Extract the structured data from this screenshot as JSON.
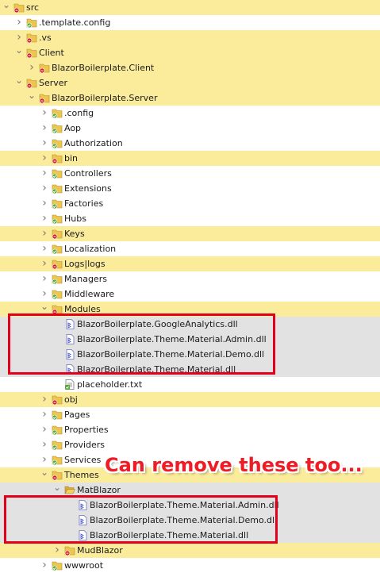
{
  "tree": [
    {
      "label": "src",
      "chevron": "down",
      "icon": "folder-red-icon",
      "bg": "yellow",
      "depth": 0
    },
    {
      "label": ".template.config",
      "chevron": "right",
      "icon": "folder-green-icon",
      "bg": "white",
      "depth": 1
    },
    {
      "label": ".vs",
      "chevron": "right",
      "icon": "folder-red-icon",
      "bg": "yellow",
      "depth": 1
    },
    {
      "label": "Client",
      "chevron": "down",
      "icon": "folder-red-icon",
      "bg": "yellow",
      "depth": 1
    },
    {
      "label": "BlazorBoilerplate.Client",
      "chevron": "right",
      "icon": "folder-red-icon",
      "bg": "yellow",
      "depth": 2
    },
    {
      "label": "Server",
      "chevron": "down",
      "icon": "folder-red-icon",
      "bg": "yellow",
      "depth": 1
    },
    {
      "label": "BlazorBoilerplate.Server",
      "chevron": "down",
      "icon": "folder-red-icon",
      "bg": "yellow",
      "depth": 2
    },
    {
      "label": ".config",
      "chevron": "right",
      "icon": "folder-green-icon",
      "bg": "white",
      "depth": 3
    },
    {
      "label": "Aop",
      "chevron": "right",
      "icon": "folder-green-icon",
      "bg": "white",
      "depth": 3
    },
    {
      "label": "Authorization",
      "chevron": "right",
      "icon": "folder-green-icon",
      "bg": "white",
      "depth": 3
    },
    {
      "label": "bin",
      "chevron": "right",
      "icon": "folder-red-icon",
      "bg": "yellow",
      "depth": 3
    },
    {
      "label": "Controllers",
      "chevron": "right",
      "icon": "folder-green-icon",
      "bg": "white",
      "depth": 3
    },
    {
      "label": "Extensions",
      "chevron": "right",
      "icon": "folder-green-icon",
      "bg": "white",
      "depth": 3
    },
    {
      "label": "Factories",
      "chevron": "right",
      "icon": "folder-green-icon",
      "bg": "white",
      "depth": 3
    },
    {
      "label": "Hubs",
      "chevron": "right",
      "icon": "folder-green-icon",
      "bg": "white",
      "depth": 3
    },
    {
      "label": "Keys",
      "chevron": "right",
      "icon": "folder-red-icon",
      "bg": "yellow",
      "depth": 3
    },
    {
      "label": "Localization",
      "chevron": "right",
      "icon": "folder-green-icon",
      "bg": "white",
      "depth": 3
    },
    {
      "label": "Logs|logs",
      "chevron": "right",
      "icon": "folder-red-icon",
      "bg": "yellow",
      "depth": 3
    },
    {
      "label": "Managers",
      "chevron": "right",
      "icon": "folder-green-icon",
      "bg": "white",
      "depth": 3
    },
    {
      "label": "Middleware",
      "chevron": "right",
      "icon": "folder-green-icon",
      "bg": "white",
      "depth": 3
    },
    {
      "label": "Modules",
      "chevron": "down",
      "icon": "folder-red-icon",
      "bg": "yellow",
      "depth": 3
    },
    {
      "label": "BlazorBoilerplate.GoogleAnalytics.dll",
      "chevron": "",
      "icon": "dll-file-icon",
      "bg": "gray",
      "depth": 4
    },
    {
      "label": "BlazorBoilerplate.Theme.Material.Admin.dll",
      "chevron": "",
      "icon": "dll-file-icon",
      "bg": "gray",
      "depth": 4
    },
    {
      "label": "BlazorBoilerplate.Theme.Material.Demo.dll",
      "chevron": "",
      "icon": "dll-file-icon",
      "bg": "gray",
      "depth": 4
    },
    {
      "label": "BlazorBoilerplate.Theme.Material.dll",
      "chevron": "",
      "icon": "dll-file-icon",
      "bg": "gray",
      "depth": 4
    },
    {
      "label": "placeholder.txt",
      "chevron": "",
      "icon": "text-file-icon",
      "bg": "white",
      "depth": 4
    },
    {
      "label": "obj",
      "chevron": "right",
      "icon": "folder-red-icon",
      "bg": "yellow",
      "depth": 3
    },
    {
      "label": "Pages",
      "chevron": "right",
      "icon": "folder-green-icon",
      "bg": "white",
      "depth": 3
    },
    {
      "label": "Properties",
      "chevron": "right",
      "icon": "folder-green-icon",
      "bg": "white",
      "depth": 3
    },
    {
      "label": "Providers",
      "chevron": "right",
      "icon": "folder-green-icon",
      "bg": "white",
      "depth": 3
    },
    {
      "label": "Services",
      "chevron": "right",
      "icon": "folder-green-icon",
      "bg": "white",
      "depth": 3
    },
    {
      "label": "Themes",
      "chevron": "down",
      "icon": "folder-red-icon",
      "bg": "yellow",
      "depth": 3
    },
    {
      "label": "MatBlazor",
      "chevron": "down",
      "icon": "folder-open-icon",
      "bg": "gray",
      "depth": 4
    },
    {
      "label": "BlazorBoilerplate.Theme.Material.Admin.dll",
      "chevron": "",
      "icon": "dll-file-icon",
      "bg": "gray",
      "depth": 5
    },
    {
      "label": "BlazorBoilerplate.Theme.Material.Demo.dll",
      "chevron": "",
      "icon": "dll-file-icon",
      "bg": "gray",
      "depth": 5
    },
    {
      "label": "BlazorBoilerplate.Theme.Material.dll",
      "chevron": "",
      "icon": "dll-file-icon",
      "bg": "gray",
      "depth": 5
    },
    {
      "label": "MudBlazor",
      "chevron": "right",
      "icon": "folder-red-icon",
      "bg": "yellow",
      "depth": 4
    },
    {
      "label": "wwwroot",
      "chevron": "right",
      "icon": "folder-green-icon",
      "bg": "white",
      "depth": 3
    }
  ],
  "annotation": {
    "text": "Can remove these too...",
    "color": "#ee1c24"
  },
  "colors": {
    "ignored_row": "#fbec9c",
    "selected_row": "#e2e2e2",
    "highlight_box": "#e3001b",
    "folder_green": "#58a83a",
    "folder_red": "#d22020",
    "folder_yellow": "#e8c25a"
  }
}
